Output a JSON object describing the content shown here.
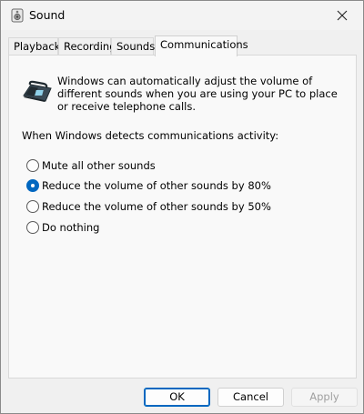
{
  "window": {
    "title": "Sound"
  },
  "tabs": [
    {
      "label": "Playback"
    },
    {
      "label": "Recording"
    },
    {
      "label": "Sounds"
    },
    {
      "label": "Communications"
    }
  ],
  "active_tab": "Communications",
  "panel": {
    "description": "Windows can automatically adjust the volume of different sounds when you are using your PC to place or receive telephone calls.",
    "when_label": "When Windows detects communications activity:",
    "options": [
      {
        "label": "Mute all other sounds",
        "checked": false
      },
      {
        "label": "Reduce the volume of other sounds by 80%",
        "checked": true
      },
      {
        "label": "Reduce the volume of other sounds by 50%",
        "checked": false
      },
      {
        "label": "Do nothing",
        "checked": false
      }
    ]
  },
  "buttons": {
    "ok": "OK",
    "cancel": "Cancel",
    "apply": "Apply",
    "apply_enabled": false
  },
  "colors": {
    "accent": "#0067c0"
  },
  "icons": {
    "title": "speaker-icon",
    "close": "close-icon",
    "panel": "telephone-icon"
  }
}
